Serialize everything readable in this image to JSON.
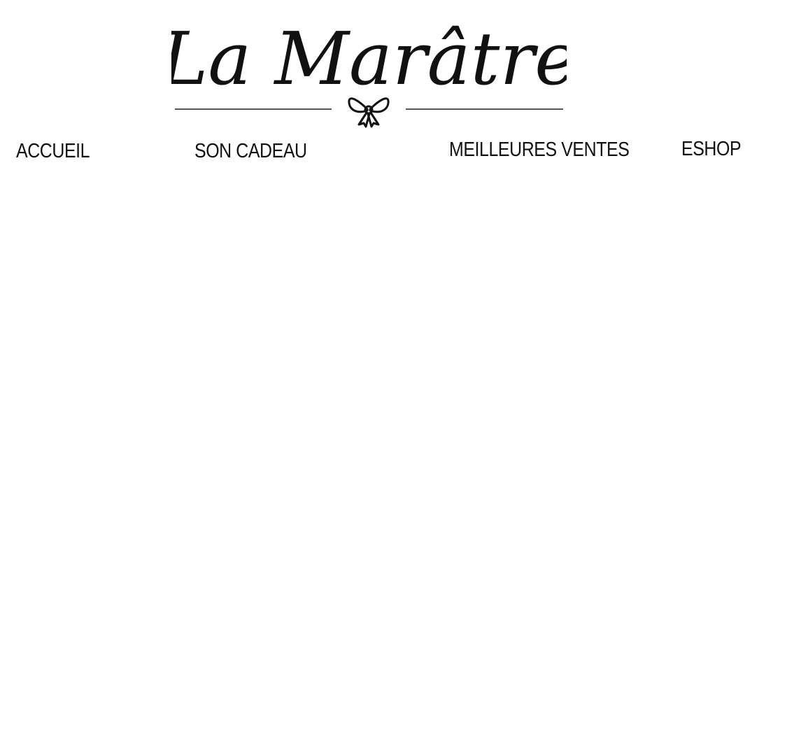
{
  "brand": {
    "name": "La Marâtre"
  },
  "nav": {
    "items": [
      {
        "label": "ACCUEIL"
      },
      {
        "label": "SON CADEAU"
      },
      {
        "label": "MEILLEURES VENTES"
      },
      {
        "label": "ESHOP"
      }
    ]
  },
  "colors": {
    "text": "#111111",
    "background": "#ffffff",
    "rule": "#555555"
  }
}
